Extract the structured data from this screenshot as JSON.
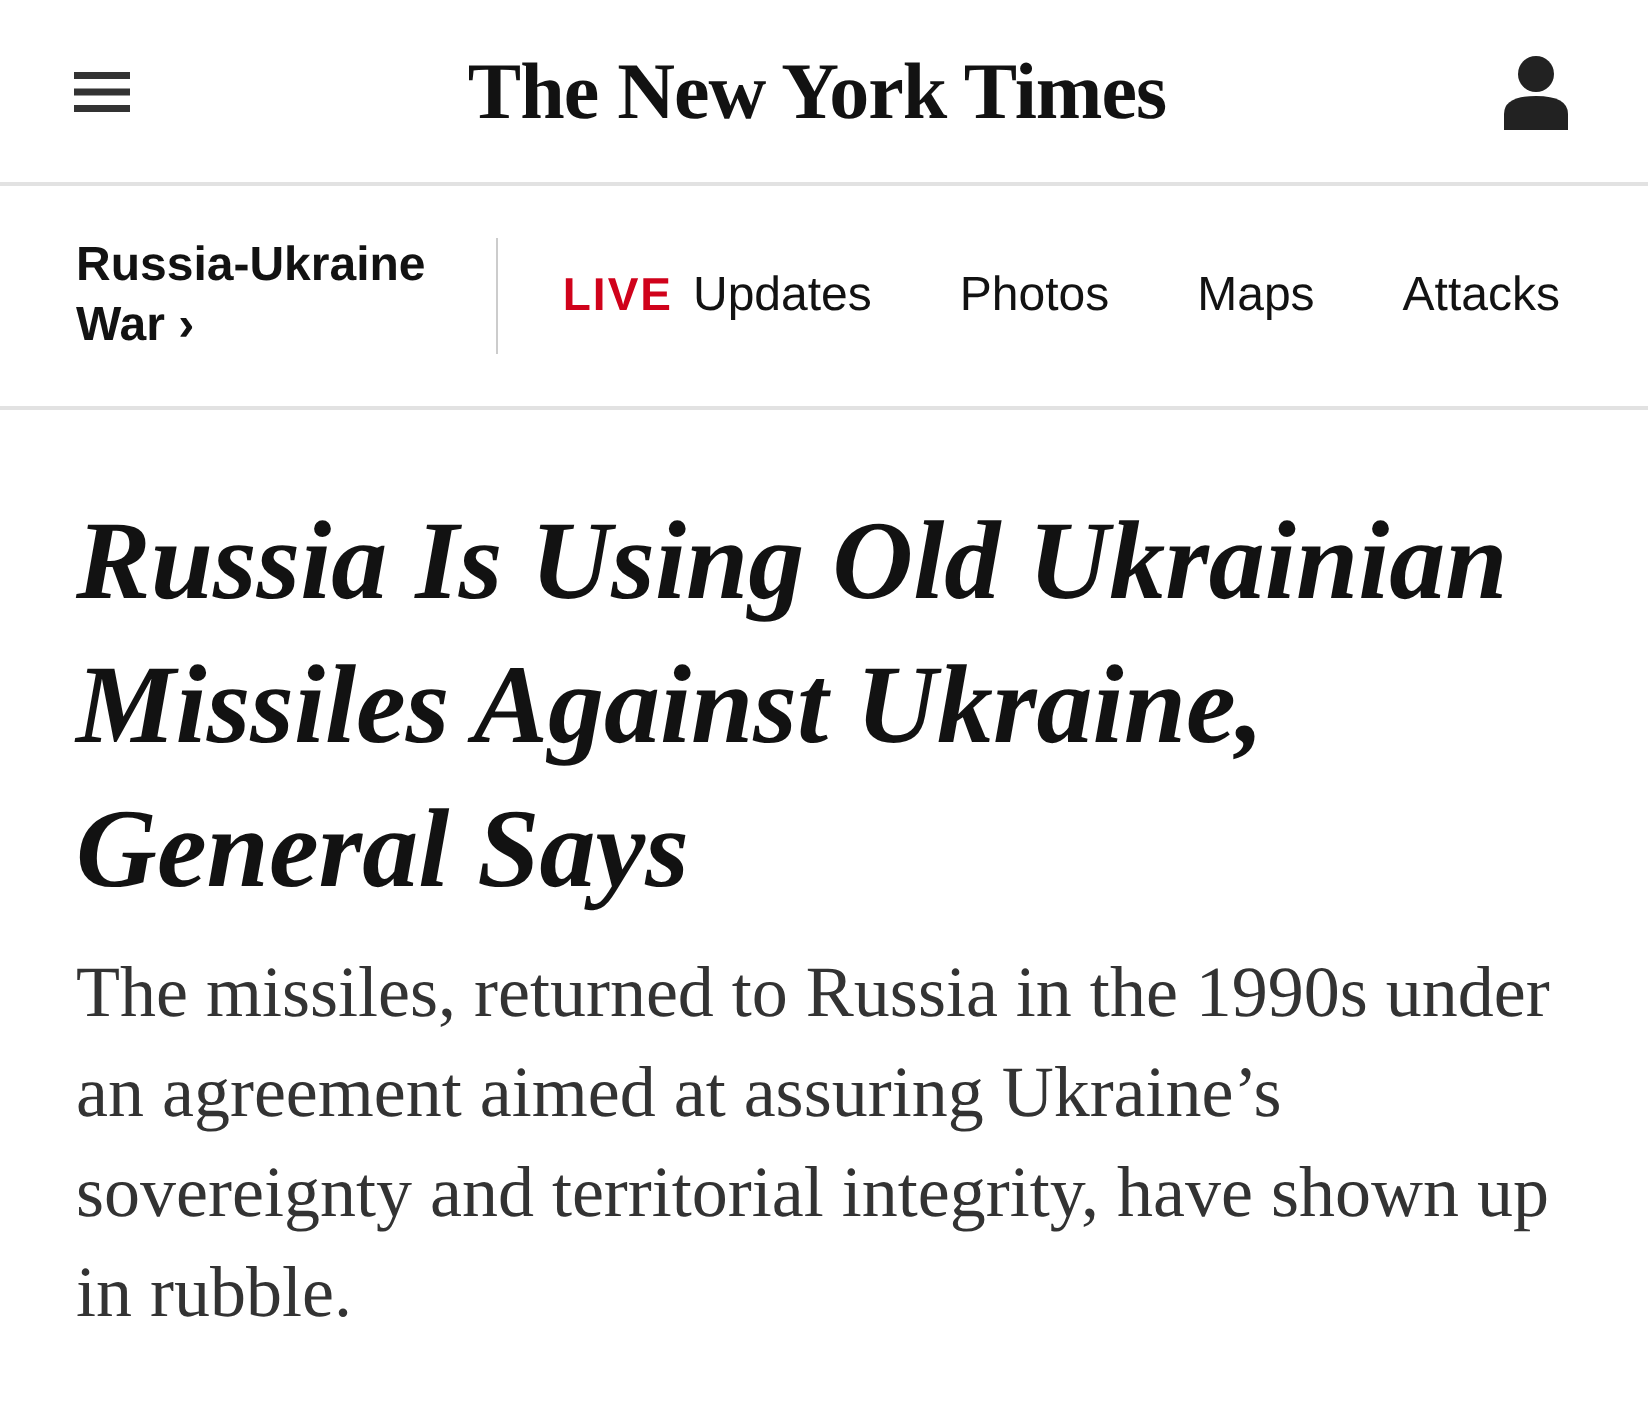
{
  "header": {
    "logo": "The New York Times"
  },
  "section_nav": {
    "section": "Russia-Ukraine War ›",
    "items": [
      {
        "kind": "live",
        "badge": "LIVE",
        "label": "Updates"
      },
      {
        "kind": "link",
        "label": "Photos"
      },
      {
        "kind": "link",
        "label": "Maps"
      },
      {
        "kind": "link",
        "label": "Attacks"
      }
    ]
  },
  "article": {
    "headline": "Russia Is Using Old Ukrainian Missiles Against Ukraine, General Says",
    "summary": "The missiles, returned to Russia in the 1990s under an agreement aimed at assuring Ukraine’s sovereignty and territorial integrity, have shown up in rubble."
  }
}
